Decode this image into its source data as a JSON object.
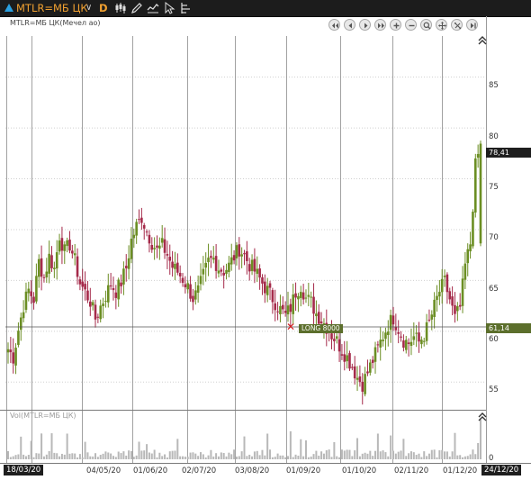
{
  "toolbar": {
    "symbol": "MTLR=МБ ЦК",
    "timeframe": "D",
    "icons": [
      "chart-type-candles-icon",
      "drawing-pencil-icon",
      "hand-drag-icon",
      "cursor-icon",
      "object-tree-icon"
    ]
  },
  "chart_title": "MTLR=МБ ЦК(Мечел ао)",
  "volume_title": "Vol(MTLR=МБ ЦК)",
  "nav_buttons": [
    "rewind-fast",
    "step-back",
    "step-forward",
    "forward-fast",
    "zoom-in",
    "zoom-out",
    "zoom-fit",
    "move",
    "reset",
    "go-end"
  ],
  "price_axis": {
    "ticks": [
      "85",
      "80",
      "75",
      "70",
      "65",
      "60",
      "55"
    ],
    "last_price": "78,41",
    "level_price": "61,14",
    "volume_zero": "0"
  },
  "order": {
    "label": "LONG 8000",
    "price": 61.14
  },
  "date_axis": {
    "start": "18/03/20",
    "end": "24/12/20",
    "ticks": [
      "04/05/20",
      "01/06/20",
      "02/07/20",
      "03/08/20",
      "01/09/20",
      "01/10/20",
      "02/11/20",
      "01/12/20"
    ]
  },
  "colors": {
    "up": "#6b8e23",
    "down": "#a52a4a",
    "grid": "#d0d0d0",
    "order_bg": "#5c6f2c",
    "accent": "#f0a030"
  },
  "chart_data": {
    "type": "candlestick",
    "ylim": [
      52.5,
      89
    ],
    "closes": [
      58.2,
      57.4,
      60.1,
      62.5,
      64.0,
      63.1,
      66.8,
      65.2,
      67.3,
      66.1,
      69.4,
      67.8,
      68.5,
      66.9,
      64.7,
      63.8,
      62.9,
      61.2,
      62.4,
      63.5,
      64.6,
      63.9,
      64.8,
      66.2,
      68.9,
      70.3,
      71.2,
      69.8,
      68.7,
      67.9,
      68.4,
      67.5,
      66.3,
      65.8,
      65.1,
      64.3,
      63.2,
      63.9,
      65.4,
      66.8,
      67.1,
      66.2,
      65.9,
      66.4,
      67.3,
      68.1,
      67.4,
      66.5,
      65.9,
      65.1,
      64.3,
      63.6,
      62.8,
      62.1,
      61.5,
      62.3,
      63.8,
      64.5,
      63.2,
      62.8,
      61.7,
      61.1,
      60.4,
      59.6,
      59.0,
      58.1,
      57.4,
      56.5,
      55.4,
      54.8,
      55.9,
      57.1,
      58.3,
      59.5,
      60.6,
      61.3,
      60.2,
      59.1,
      58.8,
      59.4,
      58.9,
      59.6,
      60.8,
      62.4,
      63.9,
      64.8,
      63.1,
      61.2,
      62.3,
      66.4,
      68.6,
      76.2,
      78.41
    ]
  }
}
